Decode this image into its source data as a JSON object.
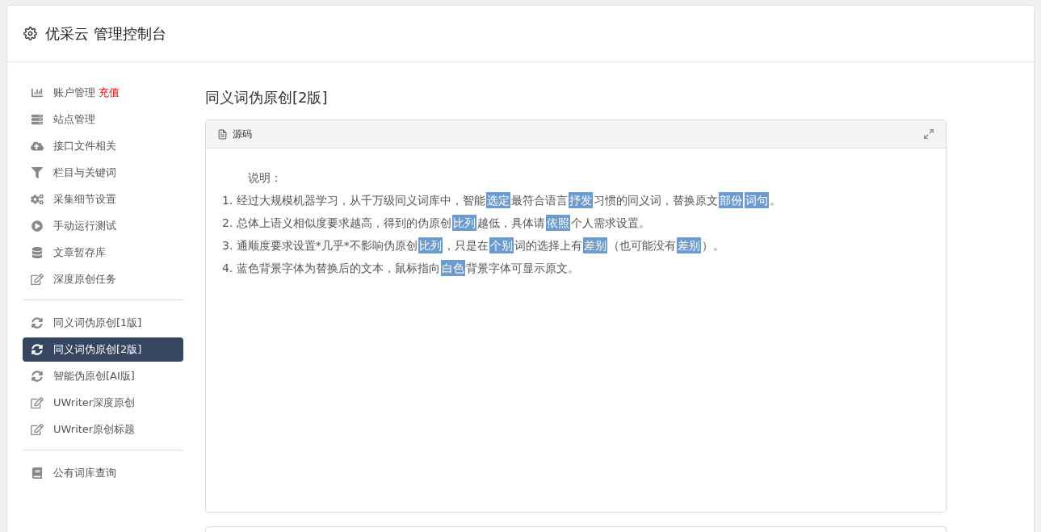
{
  "header": {
    "title": "优采云 管理控制台"
  },
  "sidebar": {
    "groups": [
      {
        "items": [
          {
            "label": "账户管理",
            "badge": "充值",
            "selected": false
          },
          {
            "label": "站点管理",
            "selected": false
          },
          {
            "label": "接口文件相关",
            "selected": false
          },
          {
            "label": "栏目与关键词",
            "selected": false
          },
          {
            "label": "采集细节设置",
            "selected": false
          },
          {
            "label": "手动运行测试",
            "selected": false
          },
          {
            "label": "文章暂存库",
            "selected": false
          },
          {
            "label": "深度原创任务",
            "selected": false
          }
        ]
      },
      {
        "items": [
          {
            "label": "同义词伪原创[1版]",
            "selected": false
          },
          {
            "label": "同义词伪原创[2版]",
            "selected": true
          },
          {
            "label": "智能伪原创[AI版]",
            "selected": false
          },
          {
            "label": "UWriter深度原创",
            "selected": false
          },
          {
            "label": "UWriter原创标题",
            "selected": false
          }
        ]
      },
      {
        "items": [
          {
            "label": "公有词库查询",
            "selected": false
          }
        ]
      }
    ]
  },
  "main": {
    "title": "同义词伪原创[2版]",
    "panel": {
      "tab": "源码",
      "heading": "说明：",
      "lines": [
        [
          {
            "text": "1. 经过大规模机器学习，从千万级同义词库中，智能",
            "highlighted": false
          },
          {
            "text": "选定",
            "highlighted": true
          },
          {
            "text": "最符合语言",
            "highlighted": false
          },
          {
            "text": "抒发",
            "highlighted": true
          },
          {
            "text": "习惯的同义词，替换原文",
            "highlighted": false
          },
          {
            "text": "部份",
            "highlighted": true
          },
          {
            "text": "词句",
            "highlighted": true
          },
          {
            "text": "。",
            "highlighted": false
          }
        ],
        [
          {
            "text": "2. 总体上语义相似度要求越高，得到的伪原创",
            "highlighted": false
          },
          {
            "text": "比列",
            "highlighted": true
          },
          {
            "text": "越低，具体请",
            "highlighted": false
          },
          {
            "text": "依照",
            "highlighted": true
          },
          {
            "text": "个人需求设置。",
            "highlighted": false
          }
        ],
        [
          {
            "text": "3. 通顺度要求设置*几乎*不影响伪原创",
            "highlighted": false
          },
          {
            "text": "比列",
            "highlighted": true
          },
          {
            "text": "，只是在",
            "highlighted": false
          },
          {
            "text": "个别",
            "highlighted": true
          },
          {
            "text": "词的选择上有",
            "highlighted": false
          },
          {
            "text": "差别",
            "highlighted": true
          },
          {
            "text": "（也可能没有",
            "highlighted": false
          },
          {
            "text": "差别",
            "highlighted": true
          },
          {
            "text": "）。",
            "highlighted": false
          }
        ],
        [
          {
            "text": "4. 蓝色背景字体为替换后的文本，鼠标指向",
            "highlighted": false
          },
          {
            "text": "白色",
            "highlighted": true
          },
          {
            "text": "背景字体可显示原文。",
            "highlighted": false
          }
        ]
      ]
    }
  }
}
